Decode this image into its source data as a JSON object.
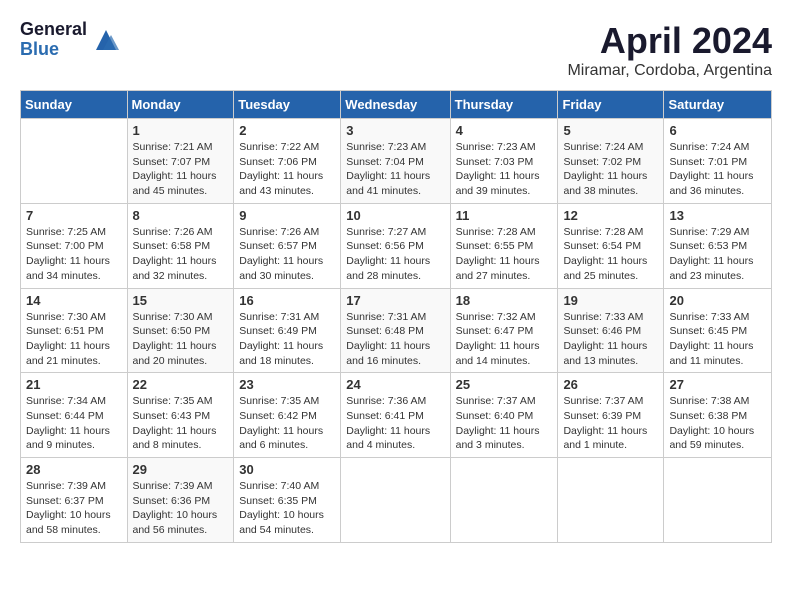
{
  "logo": {
    "general": "General",
    "blue": "Blue"
  },
  "title": "April 2024",
  "location": "Miramar, Cordoba, Argentina",
  "headers": [
    "Sunday",
    "Monday",
    "Tuesday",
    "Wednesday",
    "Thursday",
    "Friday",
    "Saturday"
  ],
  "weeks": [
    [
      {
        "day": "",
        "sunrise": "",
        "sunset": "",
        "daylight": ""
      },
      {
        "day": "1",
        "sunrise": "Sunrise: 7:21 AM",
        "sunset": "Sunset: 7:07 PM",
        "daylight": "Daylight: 11 hours and 45 minutes."
      },
      {
        "day": "2",
        "sunrise": "Sunrise: 7:22 AM",
        "sunset": "Sunset: 7:06 PM",
        "daylight": "Daylight: 11 hours and 43 minutes."
      },
      {
        "day": "3",
        "sunrise": "Sunrise: 7:23 AM",
        "sunset": "Sunset: 7:04 PM",
        "daylight": "Daylight: 11 hours and 41 minutes."
      },
      {
        "day": "4",
        "sunrise": "Sunrise: 7:23 AM",
        "sunset": "Sunset: 7:03 PM",
        "daylight": "Daylight: 11 hours and 39 minutes."
      },
      {
        "day": "5",
        "sunrise": "Sunrise: 7:24 AM",
        "sunset": "Sunset: 7:02 PM",
        "daylight": "Daylight: 11 hours and 38 minutes."
      },
      {
        "day": "6",
        "sunrise": "Sunrise: 7:24 AM",
        "sunset": "Sunset: 7:01 PM",
        "daylight": "Daylight: 11 hours and 36 minutes."
      }
    ],
    [
      {
        "day": "7",
        "sunrise": "Sunrise: 7:25 AM",
        "sunset": "Sunset: 7:00 PM",
        "daylight": "Daylight: 11 hours and 34 minutes."
      },
      {
        "day": "8",
        "sunrise": "Sunrise: 7:26 AM",
        "sunset": "Sunset: 6:58 PM",
        "daylight": "Daylight: 11 hours and 32 minutes."
      },
      {
        "day": "9",
        "sunrise": "Sunrise: 7:26 AM",
        "sunset": "Sunset: 6:57 PM",
        "daylight": "Daylight: 11 hours and 30 minutes."
      },
      {
        "day": "10",
        "sunrise": "Sunrise: 7:27 AM",
        "sunset": "Sunset: 6:56 PM",
        "daylight": "Daylight: 11 hours and 28 minutes."
      },
      {
        "day": "11",
        "sunrise": "Sunrise: 7:28 AM",
        "sunset": "Sunset: 6:55 PM",
        "daylight": "Daylight: 11 hours and 27 minutes."
      },
      {
        "day": "12",
        "sunrise": "Sunrise: 7:28 AM",
        "sunset": "Sunset: 6:54 PM",
        "daylight": "Daylight: 11 hours and 25 minutes."
      },
      {
        "day": "13",
        "sunrise": "Sunrise: 7:29 AM",
        "sunset": "Sunset: 6:53 PM",
        "daylight": "Daylight: 11 hours and 23 minutes."
      }
    ],
    [
      {
        "day": "14",
        "sunrise": "Sunrise: 7:30 AM",
        "sunset": "Sunset: 6:51 PM",
        "daylight": "Daylight: 11 hours and 21 minutes."
      },
      {
        "day": "15",
        "sunrise": "Sunrise: 7:30 AM",
        "sunset": "Sunset: 6:50 PM",
        "daylight": "Daylight: 11 hours and 20 minutes."
      },
      {
        "day": "16",
        "sunrise": "Sunrise: 7:31 AM",
        "sunset": "Sunset: 6:49 PM",
        "daylight": "Daylight: 11 hours and 18 minutes."
      },
      {
        "day": "17",
        "sunrise": "Sunrise: 7:31 AM",
        "sunset": "Sunset: 6:48 PM",
        "daylight": "Daylight: 11 hours and 16 minutes."
      },
      {
        "day": "18",
        "sunrise": "Sunrise: 7:32 AM",
        "sunset": "Sunset: 6:47 PM",
        "daylight": "Daylight: 11 hours and 14 minutes."
      },
      {
        "day": "19",
        "sunrise": "Sunrise: 7:33 AM",
        "sunset": "Sunset: 6:46 PM",
        "daylight": "Daylight: 11 hours and 13 minutes."
      },
      {
        "day": "20",
        "sunrise": "Sunrise: 7:33 AM",
        "sunset": "Sunset: 6:45 PM",
        "daylight": "Daylight: 11 hours and 11 minutes."
      }
    ],
    [
      {
        "day": "21",
        "sunrise": "Sunrise: 7:34 AM",
        "sunset": "Sunset: 6:44 PM",
        "daylight": "Daylight: 11 hours and 9 minutes."
      },
      {
        "day": "22",
        "sunrise": "Sunrise: 7:35 AM",
        "sunset": "Sunset: 6:43 PM",
        "daylight": "Daylight: 11 hours and 8 minutes."
      },
      {
        "day": "23",
        "sunrise": "Sunrise: 7:35 AM",
        "sunset": "Sunset: 6:42 PM",
        "daylight": "Daylight: 11 hours and 6 minutes."
      },
      {
        "day": "24",
        "sunrise": "Sunrise: 7:36 AM",
        "sunset": "Sunset: 6:41 PM",
        "daylight": "Daylight: 11 hours and 4 minutes."
      },
      {
        "day": "25",
        "sunrise": "Sunrise: 7:37 AM",
        "sunset": "Sunset: 6:40 PM",
        "daylight": "Daylight: 11 hours and 3 minutes."
      },
      {
        "day": "26",
        "sunrise": "Sunrise: 7:37 AM",
        "sunset": "Sunset: 6:39 PM",
        "daylight": "Daylight: 11 hours and 1 minute."
      },
      {
        "day": "27",
        "sunrise": "Sunrise: 7:38 AM",
        "sunset": "Sunset: 6:38 PM",
        "daylight": "Daylight: 10 hours and 59 minutes."
      }
    ],
    [
      {
        "day": "28",
        "sunrise": "Sunrise: 7:39 AM",
        "sunset": "Sunset: 6:37 PM",
        "daylight": "Daylight: 10 hours and 58 minutes."
      },
      {
        "day": "29",
        "sunrise": "Sunrise: 7:39 AM",
        "sunset": "Sunset: 6:36 PM",
        "daylight": "Daylight: 10 hours and 56 minutes."
      },
      {
        "day": "30",
        "sunrise": "Sunrise: 7:40 AM",
        "sunset": "Sunset: 6:35 PM",
        "daylight": "Daylight: 10 hours and 54 minutes."
      },
      {
        "day": "",
        "sunrise": "",
        "sunset": "",
        "daylight": ""
      },
      {
        "day": "",
        "sunrise": "",
        "sunset": "",
        "daylight": ""
      },
      {
        "day": "",
        "sunrise": "",
        "sunset": "",
        "daylight": ""
      },
      {
        "day": "",
        "sunrise": "",
        "sunset": "",
        "daylight": ""
      }
    ]
  ]
}
